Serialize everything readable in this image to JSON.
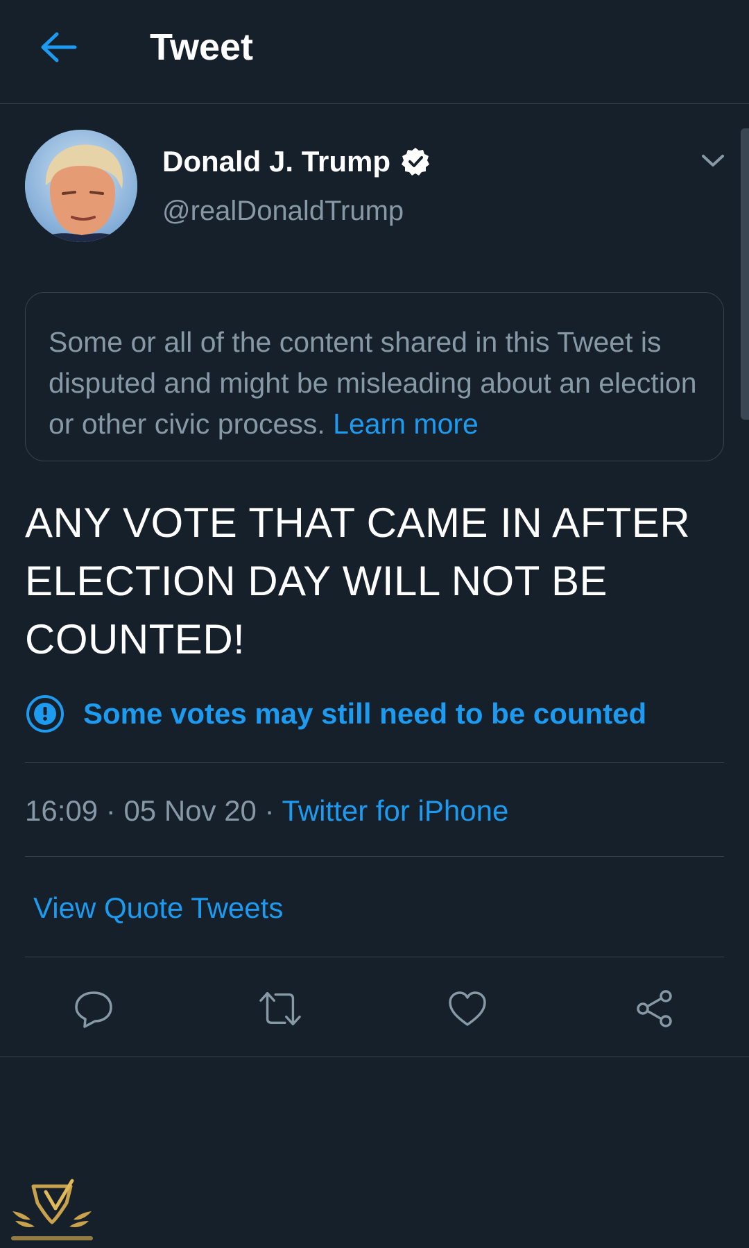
{
  "header": {
    "title": "Tweet",
    "back_icon": "arrow-left-icon"
  },
  "author": {
    "name": "Donald J. Trump",
    "handle": "@realDonaldTrump",
    "verified_icon": "verified-badge-icon"
  },
  "notice": {
    "text": "Some or all of the content shared in this Tweet is disputed and might be misleading about an election or other civic process.",
    "link": "Learn more"
  },
  "tweet": {
    "text": "ANY VOTE THAT CAME IN AFTER ELECTION DAY WILL NOT BE COUNTED!"
  },
  "label": {
    "text": "Some votes may still need to be counted",
    "icon": "exclamation-circle-icon"
  },
  "meta": {
    "time": "16:09",
    "separator": "·",
    "date": "05 Nov 20",
    "source": "Twitter for iPhone"
  },
  "quote_tweets": {
    "label": "View Quote Tweets"
  },
  "actions": [
    "reply-icon",
    "retweet-icon",
    "like-icon",
    "share-icon"
  ],
  "colors": {
    "background": "#15202b",
    "accent": "#1d9bf0",
    "secondary_text": "#8899a6",
    "border": "#38444d"
  }
}
